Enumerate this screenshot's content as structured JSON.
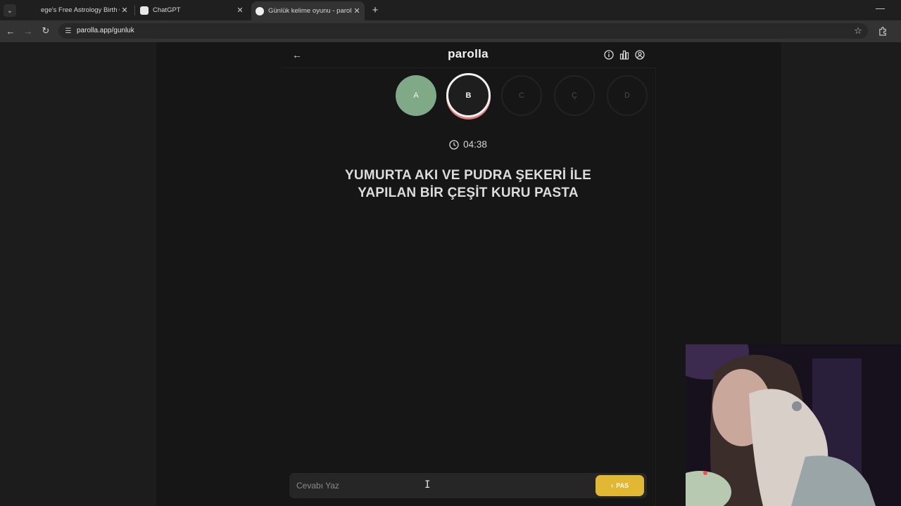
{
  "browser": {
    "tabs": [
      {
        "title": "ege's Free Astrology Birth Chart",
        "active": false
      },
      {
        "title": "ChatGPT",
        "active": false
      },
      {
        "title": "Günlük kelime oyunu - parolla",
        "active": true
      }
    ],
    "url": "parolla.app/gunluk"
  },
  "app": {
    "brand": "parolla",
    "letters": [
      {
        "letter": "A",
        "state": "done"
      },
      {
        "letter": "B",
        "state": "current"
      },
      {
        "letter": "C",
        "state": "upcoming"
      },
      {
        "letter": "Ç",
        "state": "upcoming"
      },
      {
        "letter": "D",
        "state": "upcoming"
      }
    ],
    "timer": "04:38",
    "question_line1": "YUMURTA AKI VE PUDRA ŞEKERİ İLE",
    "question_line2": "YAPILAN BİR ÇEŞİT KURU PASTA",
    "answer_placeholder": "Cevabı Yaz",
    "pass_label": "PAS"
  },
  "colors": {
    "done": "#7fa987",
    "current_ring": "#f2f2f2",
    "current_underline": "#e37c7c",
    "pass_button": "#e2b733",
    "background": "#161616"
  }
}
